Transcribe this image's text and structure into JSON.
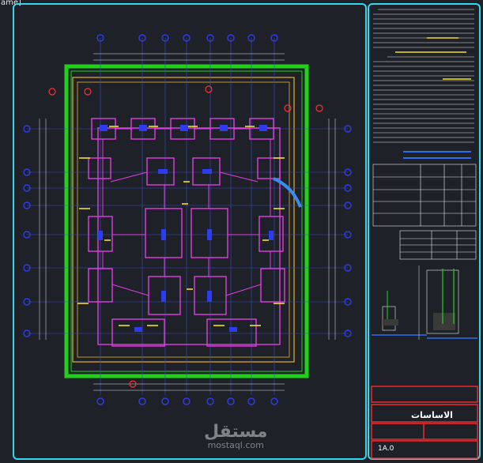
{
  "window": {
    "title_fragment": "ame]"
  },
  "title_block": {
    "sheet_title": "الاساسات",
    "sheet_number": "1A.0"
  },
  "watermark": {
    "brand_ar": "مستقل",
    "brand_en": "mostaql.com"
  },
  "colors": {
    "background": "#1e2228",
    "frame": "#35d8ea",
    "building_outline": "#22d11b",
    "footings": "#e03ee0",
    "grid_bubbles": "#2e3cf0",
    "labels": "#f2e028",
    "title_block": "#ff2a2a",
    "site_boundary": "#e8b030"
  }
}
